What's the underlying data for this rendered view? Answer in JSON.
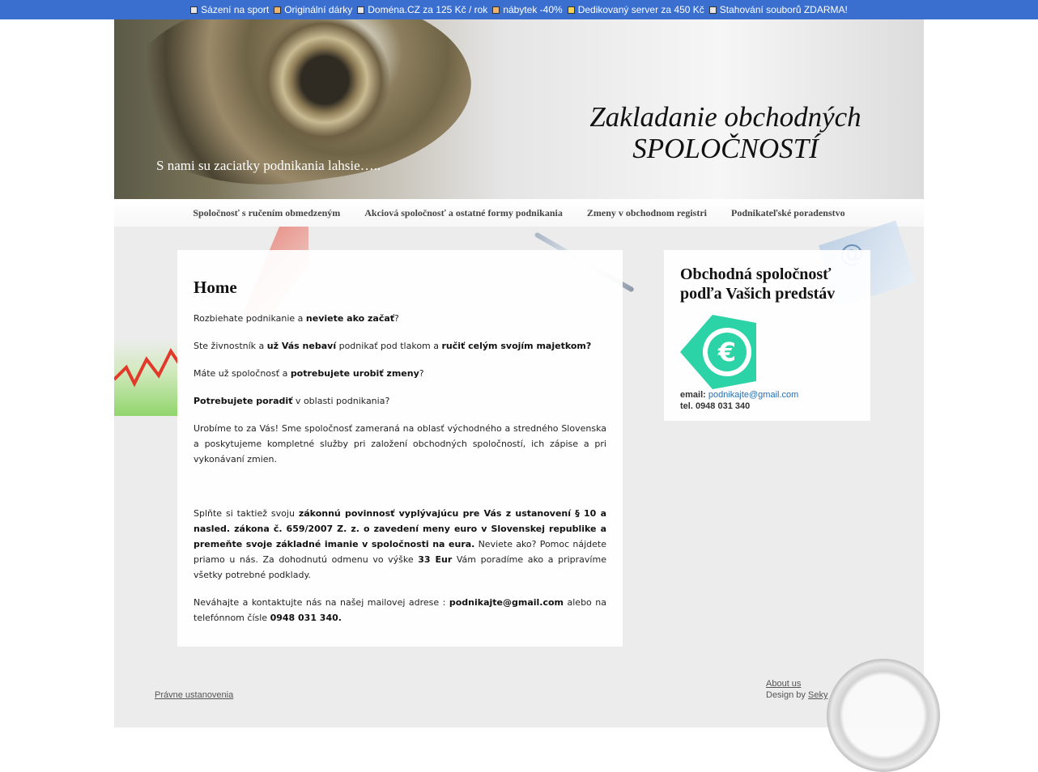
{
  "ad_bar": {
    "items": [
      {
        "label": "Sázení na sport",
        "color": "#e6e6e6"
      },
      {
        "label": "Originální dárky",
        "color": "#f1b36a"
      },
      {
        "label": "Doména.CZ za 125 Kč / rok",
        "color": "#e6e6e6"
      },
      {
        "label": "nábytek -40%",
        "color": "#f1b36a"
      },
      {
        "label": "Dedikovaný server za 450 Kč",
        "color": "#f5d25a"
      },
      {
        "label": "Stahování souborů ZDARMA!",
        "color": "#e6e6e6"
      }
    ]
  },
  "header": {
    "title_line1": "Zakladanie obchodných",
    "title_line2": "SPOLOČNOSTÍ",
    "slogan": "S nami su zaciatky podnikania lahsie….."
  },
  "nav": {
    "items": [
      "Spoločnosť s ručením obmedzeným",
      "Akciová spoločnosť a ostatné formy podnikania",
      "Zmeny v obchodnom registri",
      "Podnikateľské poradenstvo"
    ]
  },
  "main": {
    "heading": "Home",
    "p1_a": "Rozbiehate podnikanie a ",
    "p1_b": "neviete ako začať",
    "p1_c": "?",
    "p2_a": "Ste živnostník a ",
    "p2_b": "už Vás nebaví",
    "p2_c": " podnikať pod tlakom a ",
    "p2_d": "ručiť celým svojím majetkom?",
    "p3_a": "Máte už spoločnosť a ",
    "p3_b": "potrebujete urobiť zmeny",
    "p3_c": "?",
    "p4_a": "Potrebujete poradiť",
    "p4_b": " v oblasti podnikania?",
    "p5": "Urobíme to za Vás! Sme spoločnosť zameraná na oblasť východného a stredného Slovenska a poskytujeme kompletné služby pri založení obchodných spoločností, ich zápise a pri vykonávaní zmien.",
    "p6_a": "Splňte si taktiež svoju ",
    "p6_b": "zákonnú povinnosť",
    "p6_c": " vyplývajúcu pre Vás z ustanovení § 10 a nasled. zákona č. 659/2007 Z. z. o zavedení meny euro v Slovenskej republike",
    "p6_d": " a premeňte svoje základné imanie v spoločnosti na eura.",
    "p6_e": " Neviete ako? Pomoc nájdete priamo u nás. Za dohodnutú odmenu vo výške ",
    "p6_f": "33 Eur",
    "p6_g": " Vám poradíme ako a pripravíme všetky potrebné podklady.",
    "p7_a": "Neváhajte a kontaktujte nás na našej mailovej adrese : ",
    "p7_b": "podnikajte@gmail.com",
    "p7_c": " alebo na telefónnom čísle ",
    "p7_d": "0948 031 340."
  },
  "sidebar": {
    "heading": "Obchodná spoločnosť podľa Vašich predstáv",
    "email_label": "email: ",
    "email": "podnikajte@gmail.com",
    "tel": "tel. 0948 031 340",
    "logo_icon": "euro-sign-icon",
    "logo_color": "#2bd3a7"
  },
  "footer": {
    "legal": "Právne ustanovenia",
    "about": "About us",
    "design_by_prefix": "Design by ",
    "design_by_link": "Seky"
  }
}
